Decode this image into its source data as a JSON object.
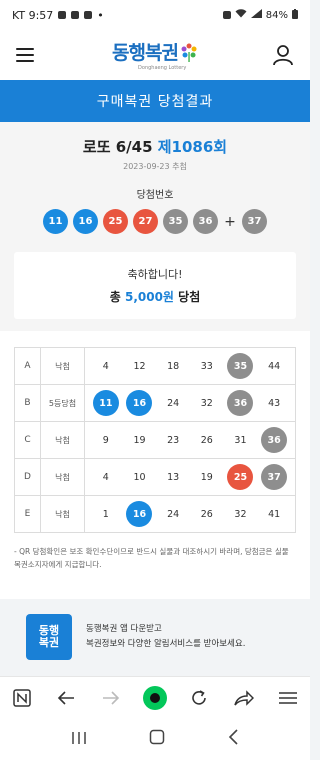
{
  "status_bar": {
    "time": "KT 9:57",
    "battery": "84%"
  },
  "header": {
    "logo_text": "동행복권",
    "logo_sub": "Donghaeng Lottery"
  },
  "page_title": "구매복권 당첨결과",
  "game": {
    "name": "로또 6/45",
    "round": "제1086회",
    "draw_date": "2023-09-23 추첨",
    "winning_label": "당첨번호",
    "winning_numbers": [
      11,
      16,
      25,
      27,
      35,
      36
    ],
    "bonus_number": 37,
    "plus": "+"
  },
  "ball_colors": {
    "blue": "#1a8be0",
    "red": "#e8553f",
    "gray": "#8e8e8e"
  },
  "congrats": {
    "line1": "축하합니다!",
    "prefix": "총",
    "amount": "5,000원",
    "suffix": "당첨"
  },
  "tickets": [
    {
      "label": "A",
      "result": "낙첨",
      "numbers": [
        4,
        12,
        18,
        33,
        35,
        44
      ]
    },
    {
      "label": "B",
      "result": "5등당첨",
      "numbers": [
        11,
        16,
        24,
        32,
        36,
        43
      ]
    },
    {
      "label": "C",
      "result": "낙첨",
      "numbers": [
        9,
        19,
        23,
        26,
        31,
        36
      ]
    },
    {
      "label": "D",
      "result": "낙첨",
      "numbers": [
        4,
        10,
        13,
        19,
        25,
        37
      ]
    },
    {
      "label": "E",
      "result": "낙첨",
      "numbers": [
        1,
        16,
        24,
        26,
        32,
        41
      ]
    }
  ],
  "notice": "- QR 당첨확인은 보조 확인수단이므로 반드시 실물과 대조하시기 바라며, 당첨금은 실물 복권소지자에게 지급합니다.",
  "promo": {
    "logo_text": "동행\n복권",
    "line1": "동행복권 앱 다운받고",
    "line2": "복권정보와 다양한 알림서비스를 받아보세요."
  }
}
